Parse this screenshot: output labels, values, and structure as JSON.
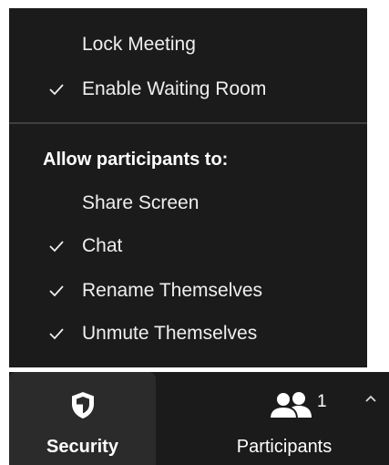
{
  "security_menu": {
    "items": [
      {
        "label": "Lock Meeting",
        "checked": false
      },
      {
        "label": "Enable Waiting Room",
        "checked": true
      }
    ],
    "section_header": "Allow participants to:",
    "allow_items": [
      {
        "label": "Share Screen",
        "checked": false
      },
      {
        "label": "Chat",
        "checked": true
      },
      {
        "label": "Rename Themselves",
        "checked": true
      },
      {
        "label": "Unmute Themselves",
        "checked": true
      }
    ]
  },
  "toolbar": {
    "security_label": "Security",
    "security_icon": "shield-icon",
    "participants_label": "Participants",
    "participants_icon": "participants-icon",
    "participants_count": "1",
    "more_icon": "chevron-up-icon"
  },
  "colors": {
    "menu_background": "#1b1b1b",
    "active_button_background": "#2b2b2b",
    "text": "#efefef",
    "divider": "#3f3f3f"
  }
}
